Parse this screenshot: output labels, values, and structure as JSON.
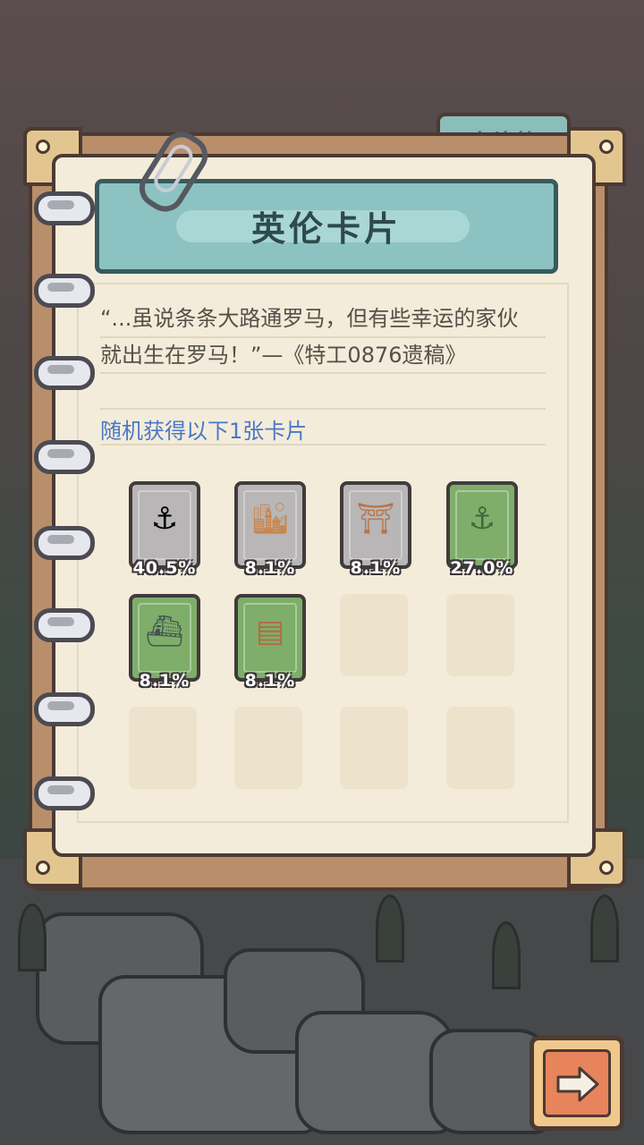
{
  "tab": {
    "label": "卡片格"
  },
  "banner": {
    "title": "英伦卡片"
  },
  "quote": {
    "line1": "“...虽说条条大路通罗马，但有些幸运的家伙",
    "line2": "就出生在罗马！”—《特工0876遗稿》"
  },
  "reward_info": {
    "text": "随机获得以下1张卡片"
  },
  "cards": [
    {
      "icon": "anchor-icon",
      "color": "gray",
      "percent": "40.5%"
    },
    {
      "icon": "skyscraper-icon",
      "color": "gray",
      "percent": "8.1%"
    },
    {
      "icon": "bridge-icon",
      "color": "gray",
      "percent": "8.1%"
    },
    {
      "icon": "anchor-icon",
      "color": "green",
      "percent": "27.0%"
    },
    {
      "icon": "aircraft-carrier-icon",
      "color": "green",
      "percent": "8.1%"
    },
    {
      "icon": "map-document-icon",
      "color": "green",
      "percent": "8.1%"
    }
  ],
  "colors": {
    "banner": "#8cc3c2",
    "paper": "#f4ecda",
    "card_gray": "#b8b6b6",
    "card_green": "#7eae6a",
    "reward_text": "#4a78c8",
    "next_button": "#e7845b"
  }
}
